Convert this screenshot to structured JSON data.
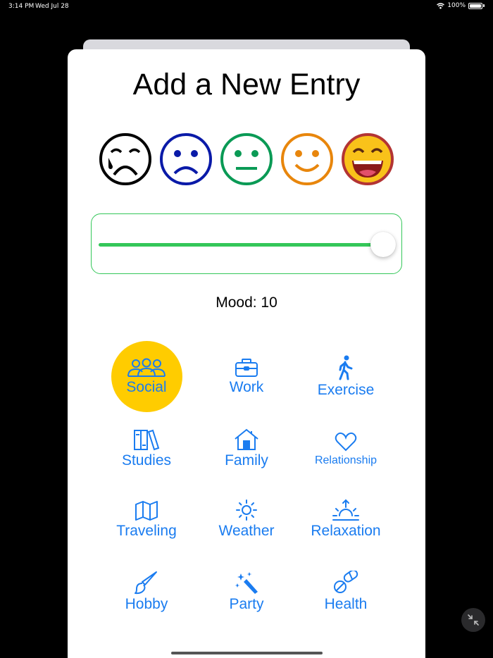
{
  "status": {
    "time": "3:14 PM",
    "date": "Wed Jul 28",
    "battery": "100%"
  },
  "title": "Add a New Entry",
  "faces": [
    {
      "icon": "crying-face-icon",
      "color": "#000000"
    },
    {
      "icon": "sad-face-icon",
      "color": "#0a1aa8"
    },
    {
      "icon": "neutral-face-icon",
      "color": "#0a9a55"
    },
    {
      "icon": "smiling-face-icon",
      "color": "#e8860c"
    },
    {
      "icon": "grinning-face-icon",
      "color": "#b33434"
    }
  ],
  "slider": {
    "value": 10,
    "min": 0,
    "max": 10,
    "color": "#34c759"
  },
  "mood_label": "Mood: 10",
  "categories": [
    {
      "label": "Social",
      "icon": "people-icon",
      "selected": true
    },
    {
      "label": "Work",
      "icon": "briefcase-icon"
    },
    {
      "label": "Exercise",
      "icon": "walking-figure-icon"
    },
    {
      "label": "Studies",
      "icon": "books-icon"
    },
    {
      "label": "Family",
      "icon": "house-icon"
    },
    {
      "label": "Relationship",
      "icon": "heart-icon"
    },
    {
      "label": "Traveling",
      "icon": "map-icon"
    },
    {
      "label": "Weather",
      "icon": "sun-icon"
    },
    {
      "label": "Relaxation",
      "icon": "sunrise-icon"
    },
    {
      "label": "Hobby",
      "icon": "paintbrush-icon"
    },
    {
      "label": "Party",
      "icon": "magic-wand-icon"
    },
    {
      "label": "Health",
      "icon": "pills-icon"
    }
  ],
  "colors": {
    "accent": "#1a7cf0",
    "selected_bg": "#ffcc00",
    "slider": "#34c759"
  }
}
